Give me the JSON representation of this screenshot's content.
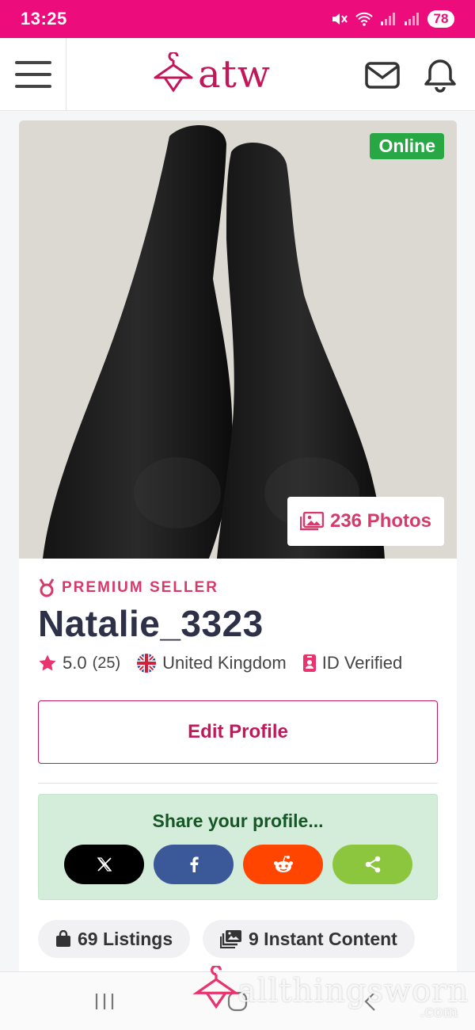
{
  "status_bar": {
    "time": "13:25",
    "battery": "78"
  },
  "header": {
    "logo_text": "atw"
  },
  "profile": {
    "online_badge": "Online",
    "photos_label": "236 Photos",
    "seller_level": "PREMIUM SELLER",
    "username": "Natalie_3323",
    "rating": "5.0",
    "rating_count": "(25)",
    "country": "United Kingdom",
    "verification": "ID Verified",
    "edit_profile_label": "Edit Profile"
  },
  "share": {
    "title": "Share your profile...",
    "buttons": [
      {
        "label": "X",
        "icon": "x-icon",
        "color": "#000000"
      },
      {
        "label": "f",
        "icon": "facebook-icon",
        "color": "#3b5998"
      },
      {
        "label": "reddit",
        "icon": "reddit-icon",
        "color": "#ff4500"
      },
      {
        "label": "share",
        "icon": "share-icon",
        "color": "#8cc63f"
      }
    ]
  },
  "stats": {
    "listings": "69 Listings",
    "instant_content": "9 Instant Content"
  },
  "watermark": {
    "text": "allthingsworn",
    "sub": ".com"
  },
  "colors": {
    "brand_pink": "#ec0c7c",
    "accent": "#c2185b",
    "online": "#28a745"
  }
}
